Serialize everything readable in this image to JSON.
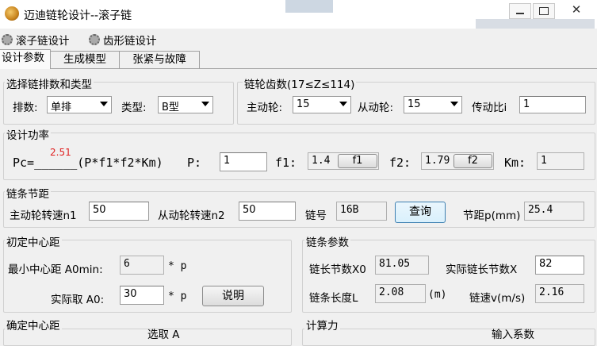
{
  "window": {
    "title": "迈迪链轮设计--滚子链"
  },
  "menu": {
    "items": [
      "滚子链设计",
      "齿形链设计"
    ]
  },
  "tabs": [
    "设计参数",
    "生成模型",
    "张紧与故障"
  ],
  "group_chain_type": {
    "title": "选择链排数和类型",
    "rows_label": "排数:",
    "rows_value": "单排",
    "type_label": "类型:",
    "type_value": "B型"
  },
  "group_teeth": {
    "title": "链轮齿数(17≤Z≤114)",
    "driver_label": "主动轮:",
    "driver_value": "15",
    "driven_label": "从动轮:",
    "driven_value": "15",
    "ratio_label": "传动比i",
    "ratio_value": "1"
  },
  "group_power": {
    "title": "设计功率",
    "pc_prefix": "Pc=______(P*f1*f2*Km)",
    "pc_value": "2.51",
    "p_label": "P:",
    "p_value": "1",
    "f1_label": "f1:",
    "f1_value": "1.4",
    "f1_button": "f1",
    "f2_label": "f2:",
    "f2_value": "1.79",
    "f2_button": "f2",
    "km_label": "Km:",
    "km_value": "1",
    "pc_color": "#e02020"
  },
  "group_pitch": {
    "title": "链条节距",
    "n1_label": "主动轮转速n1",
    "n1_value": "50",
    "n2_label": "从动轮转速n2",
    "n2_value": "50",
    "chain_no_label": "链号",
    "chain_no_value": "16B",
    "query_button": "查询",
    "pitch_label": "节距p(mm)",
    "pitch_value": "25.4"
  },
  "group_center": {
    "title": "初定中心距",
    "min_label": "最小中心距 A0min:",
    "min_value": "6",
    "min_unit": "* p",
    "actual_label": "实际取 A0:",
    "actual_value": "30",
    "actual_unit": "* p",
    "explain_button": "说明"
  },
  "group_chain_params": {
    "title": "链条参数",
    "links_label": "链长节数X0",
    "links_value": "81.05",
    "actual_links_label": "实际链长节数X",
    "actual_links_value": "82",
    "length_label": "链条长度L",
    "length_value": "2.08",
    "length_unit": "(m)",
    "speed_label": "链速v(m/s)",
    "speed_value": "2.16"
  },
  "group_final_center": {
    "title": "确定中心距",
    "partial_text": "选取 A"
  },
  "group_force": {
    "title": "计算力",
    "partial_text": "输入系数"
  }
}
